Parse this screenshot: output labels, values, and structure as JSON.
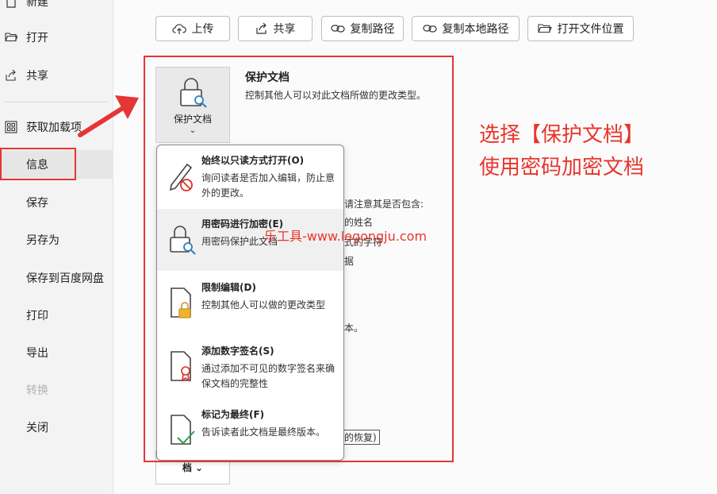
{
  "sidebar": {
    "items": [
      {
        "label": "新建",
        "icon": "new-doc-icon"
      },
      {
        "label": "打开",
        "icon": "folder-open-icon"
      },
      {
        "label": "共享",
        "icon": "share-icon"
      },
      {
        "label": "获取加载项",
        "icon": "grid-icon"
      },
      {
        "label": "信息"
      },
      {
        "label": "保存"
      },
      {
        "label": "另存为"
      },
      {
        "label": "保存到百度网盘"
      },
      {
        "label": "打印"
      },
      {
        "label": "导出"
      },
      {
        "label": "转换"
      },
      {
        "label": "关闭"
      }
    ]
  },
  "toolbar": {
    "upload": "上传",
    "share": "共享",
    "copy_path": "复制路径",
    "copy_local_path": "复制本地路径",
    "open_location": "打开文件位置"
  },
  "protect": {
    "button_label": "保护文档",
    "chevron": "⌄",
    "title": "保护文档",
    "description": "控制其他人可以对此文档所做的更改类型。"
  },
  "background": {
    "line1": "请注意其是否包含:",
    "line2": "的姓名",
    "line3": "式的字符",
    "line4": "据",
    "line5": "本。",
    "line6": "的恢复)"
  },
  "bottom_button": "档 ⌄",
  "menu": {
    "items": [
      {
        "title": "始终以只读方式打开(O)",
        "description": "询问读者是否加入编辑，防止意外的更改。",
        "icon": "pencil-prohibited-icon"
      },
      {
        "title": "用密码进行加密(E)",
        "description": "用密码保护此文档",
        "icon": "lock-key-icon"
      },
      {
        "title": "限制编辑(D)",
        "description": "控制其他人可以做的更改类型",
        "icon": "doc-lock-icon"
      },
      {
        "title": "添加数字签名(S)",
        "description": "通过添加不可见的数字签名来确保文档的完整性",
        "icon": "doc-ribbon-icon"
      },
      {
        "title": "标记为最终(F)",
        "description": "告诉读者此文档是最终版本。",
        "icon": "doc-check-icon"
      }
    ]
  },
  "annotation": {
    "line1": "选择【保护文档】",
    "line2": "使用密码加密文档",
    "watermark": "乐工具-www.legongju.com",
    "color": "#e8352b"
  }
}
